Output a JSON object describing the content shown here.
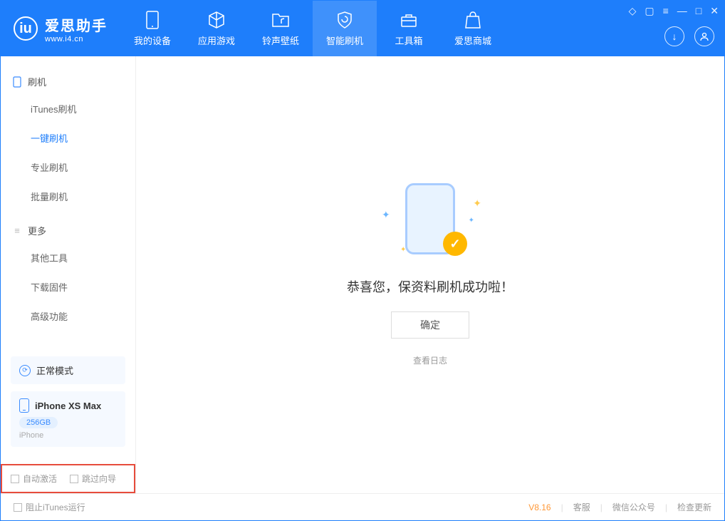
{
  "header": {
    "logo_text": "爱思助手",
    "logo_sub": "www.i4.cn",
    "tabs": [
      {
        "label": "我的设备"
      },
      {
        "label": "应用游戏"
      },
      {
        "label": "铃声壁纸"
      },
      {
        "label": "智能刷机"
      },
      {
        "label": "工具箱"
      },
      {
        "label": "爱思商城"
      }
    ]
  },
  "sidebar": {
    "section1": {
      "title": "刷机",
      "items": [
        {
          "label": "iTunes刷机"
        },
        {
          "label": "一键刷机"
        },
        {
          "label": "专业刷机"
        },
        {
          "label": "批量刷机"
        }
      ]
    },
    "section2": {
      "title": "更多",
      "items": [
        {
          "label": "其他工具"
        },
        {
          "label": "下载固件"
        },
        {
          "label": "高级功能"
        }
      ]
    },
    "mode_card": {
      "title": "正常模式"
    },
    "device_card": {
      "name": "iPhone XS Max",
      "storage": "256GB",
      "type": "iPhone"
    },
    "checks": {
      "auto_activate": "自动激活",
      "skip_guide": "跳过向导"
    }
  },
  "main": {
    "success_text": "恭喜您，保资料刷机成功啦！",
    "ok_button": "确定",
    "log_link": "查看日志"
  },
  "footer": {
    "stop_itunes": "阻止iTunes运行",
    "version": "V8.16",
    "links": {
      "support": "客服",
      "wechat": "微信公众号",
      "update": "检查更新"
    }
  }
}
